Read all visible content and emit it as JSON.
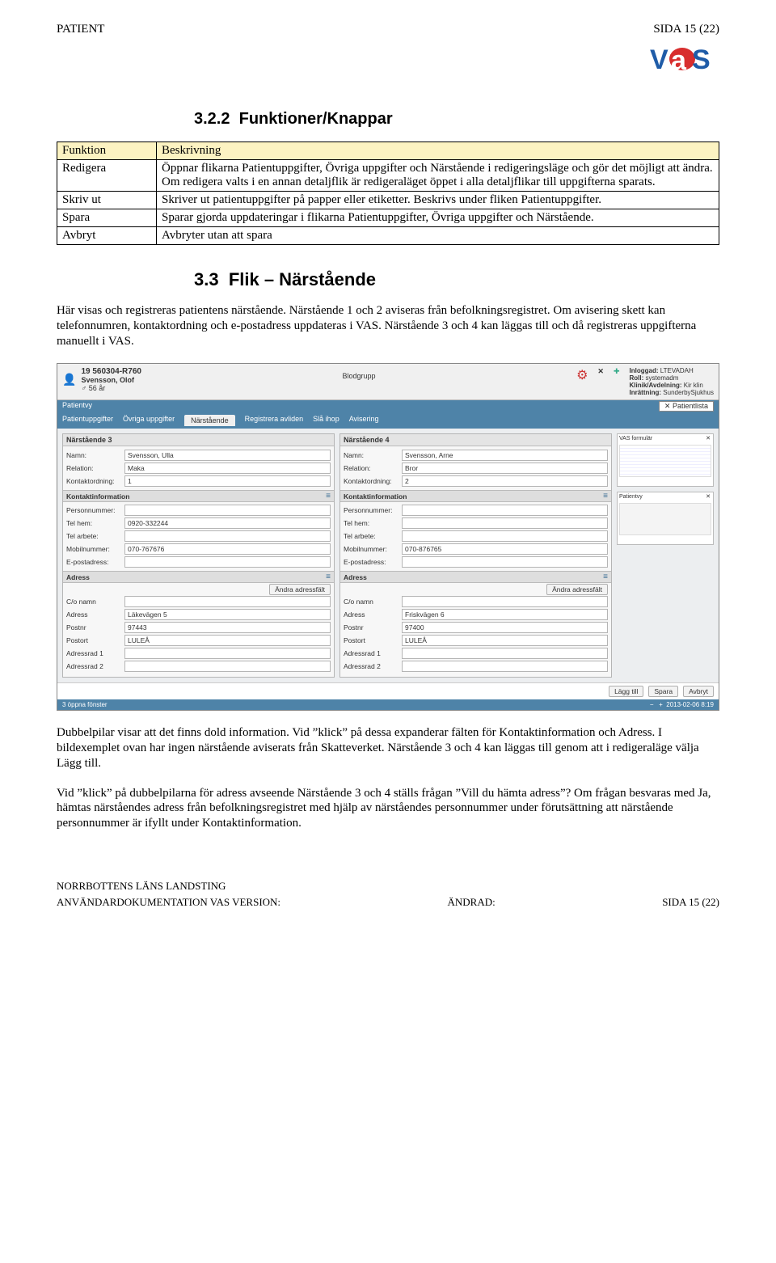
{
  "header": {
    "left": "PATIENT",
    "right": "SIDA 15 (22)"
  },
  "logo_name": "vas-logo",
  "section_a": {
    "number": "3.2.2",
    "title": "Funktioner/Knappar"
  },
  "funcs_table": {
    "cols": [
      "Funktion",
      "Beskrivning"
    ],
    "rows": [
      {
        "f": "Redigera",
        "b": "Öppnar flikarna Patientuppgifter, Övriga uppgifter och Närstående i redigeringsläge och gör det möjligt att ändra. Om redigera valts i en annan detaljflik är redigeraläget öppet i alla detaljflikar till uppgifterna sparats."
      },
      {
        "f": "Skriv ut",
        "b": "Skriver ut patientuppgifter på papper eller etiketter. Beskrivs under fliken Patientuppgifter."
      },
      {
        "f": "Spara",
        "b": "Sparar gjorda uppdateringar i flikarna Patientuppgifter, Övriga uppgifter och Närstående."
      },
      {
        "f": "Avbryt",
        "b": "Avbryter utan att spara"
      }
    ]
  },
  "section_b": {
    "number": "3.3",
    "title": "Flik – Närstående"
  },
  "para1": "Här visas och registreras patientens närstående. Närstående 1 och 2 aviseras från befolkningsregistret. Om avisering skett kan telefonnumren, kontaktordning och e-postadress uppdateras i VAS. Närstående 3 och 4 kan läggas till och då registreras uppgifterna manuellt i VAS.",
  "shot": {
    "pid": "19 560304-R760",
    "pname": "Svensson, Olof",
    "age": "♂ 56 år",
    "blood": "Blodgrupp",
    "login": {
      "rows": [
        [
          "Inloggad:",
          "LTEVADAH"
        ],
        [
          "Roll:",
          "systemadm"
        ],
        [
          "Klinik/Avdelning:",
          "Kir klin"
        ],
        [
          "Inrättning:",
          "SunderbySjukhus"
        ]
      ]
    },
    "viewlabel": "Patientvy",
    "patientlista": "Patientlista",
    "tabs": [
      "Patientuppgifter",
      "Övriga uppgifter",
      "Närstående",
      "Registrera avliden",
      "Slå ihop",
      "Avisering"
    ],
    "active_tab": "Närstående",
    "nk3": {
      "title": "Närstående 3",
      "namn": "Svensson, Ulla",
      "relation": "Maka",
      "kontaktordning": "1",
      "kontaktinfo_label": "Kontaktinformation",
      "personnummer": "",
      "tel_hem": "0920-332244",
      "tel_arbete": "",
      "mobil": "070-767676",
      "epost": "",
      "adress_label": "Adress",
      "andra": "Ändra adressfält",
      "co": "",
      "adress": "Läkevägen 5",
      "postnr": "97443",
      "postort": "LULEÅ",
      "adr1": "",
      "adr2": ""
    },
    "nk4": {
      "title": "Närstående 4",
      "namn": "Svensson, Arne",
      "relation": "Bror",
      "kontaktordning": "2",
      "kontaktinfo_label": "Kontaktinformation",
      "personnummer": "",
      "tel_hem": "",
      "tel_arbete": "",
      "mobil": "070-876765",
      "epost": "",
      "adress_label": "Adress",
      "andra": "Ändra adressfält",
      "co": "",
      "adress": "Friskvägen 6",
      "postnr": "97400",
      "postort": "LULEÅ",
      "adr1": "",
      "adr2": ""
    },
    "labels": {
      "namn": "Namn:",
      "relation": "Relation:",
      "kontaktordning": "Kontaktordning:",
      "personnummer": "Personnummer:",
      "tel_hem": "Tel hem:",
      "tel_arbete": "Tel arbete:",
      "mobil": "Mobilnummer:",
      "epost": "E-postadress:",
      "co": "C/o namn",
      "adress": "Adress",
      "postnr": "Postnr",
      "postort": "Postort",
      "adr1": "Adressrad 1",
      "adr2": "Adressrad 2"
    },
    "side": {
      "vasform": "VAS formulär",
      "patientvy": "Patientvy"
    },
    "buttons": {
      "lagg": "Lägg till",
      "spara": "Spara",
      "avbryt": "Avbryt"
    },
    "status_left": "3 öppna fönster",
    "status_right": "2013-02-06  8:19"
  },
  "para2": "Dubbelpilar visar att det finns dold information. Vid ”klick” på dessa expanderar fälten för Kontaktinformation och Adress. I bildexemplet ovan har ingen närstående aviserats från Skatteverket. Närstående 3 och 4 kan läggas till genom att i redigeraläge välja Lägg till.",
  "para3": "Vid ”klick” på dubbelpilarna för adress avseende Närstående 3 och 4 ställs frågan ”Vill du hämta adress”? Om frågan besvaras med Ja, hämtas närståendes adress från befolkningsregistret med hjälp av närståendes personnummer under förutsättning att närstående personnummer är ifyllt under Kontaktinformation.",
  "footer": {
    "l1": "NORRBOTTENS LÄNS LANDSTING",
    "l2a": "ANVÄNDARDOKUMENTATION VAS VERSION:",
    "l2b": "ÄNDRAD:",
    "l2c": "SIDA 15 (22)"
  }
}
